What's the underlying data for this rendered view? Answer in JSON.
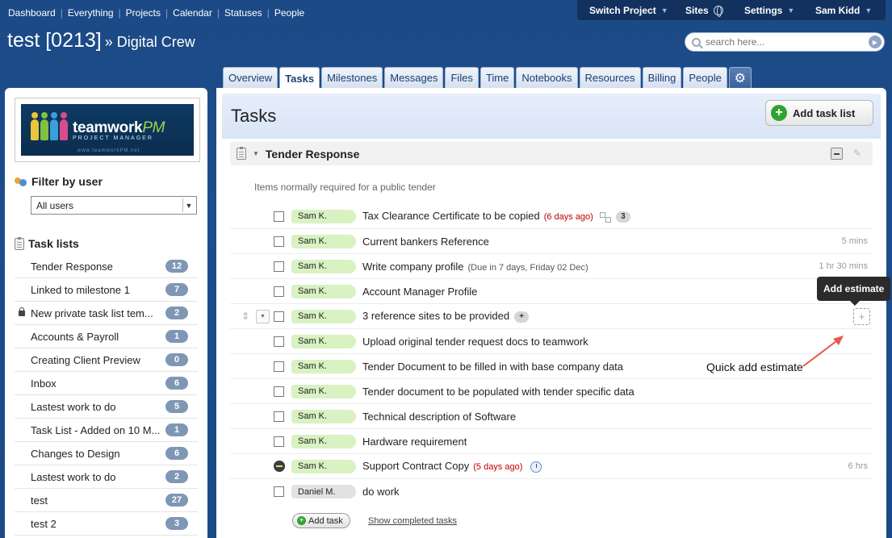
{
  "topnav": [
    "Dashboard",
    "Everything",
    "Projects",
    "Calendar",
    "Statuses",
    "People"
  ],
  "topright": {
    "switch_project": "Switch Project",
    "sites": "Sites",
    "settings": "Settings",
    "user": "Sam Kidd"
  },
  "project": {
    "title": "test [0213]",
    "company": "» Digital Crew"
  },
  "search": {
    "placeholder": "search here..."
  },
  "tabs": [
    "Overview",
    "Tasks",
    "Milestones",
    "Messages",
    "Files",
    "Time",
    "Notebooks",
    "Resources",
    "Billing",
    "People"
  ],
  "active_tab": "Tasks",
  "sidebar": {
    "logo": {
      "name_main": "teamwork",
      "name_pm": "PM",
      "sub": "PROJECT MANAGER",
      "url": "www.teamworkPM.net"
    },
    "filter_heading": "Filter by user",
    "filter_value": "All users",
    "tasklists_heading": "Task lists",
    "tasklists": [
      {
        "label": "Tender Response",
        "count": "12"
      },
      {
        "label": "Linked to milestone 1",
        "count": "7"
      },
      {
        "label": "New private task list tem...",
        "count": "2"
      },
      {
        "label": "Accounts & Payroll",
        "count": "1"
      },
      {
        "label": "Creating Client Preview",
        "count": "0"
      },
      {
        "label": "Inbox",
        "count": "6"
      },
      {
        "label": "Lastest work to do",
        "count": "5"
      },
      {
        "label": "Task List - Added on 10 M...",
        "count": "1"
      },
      {
        "label": "Changes to Design",
        "count": "6"
      },
      {
        "label": "Lastest work to do",
        "count": "2"
      },
      {
        "label": "test",
        "count": "27"
      },
      {
        "label": "test 2",
        "count": "3"
      }
    ]
  },
  "main": {
    "title": "Tasks",
    "add_task_list": "Add task list",
    "tasklist_title": "Tender Response",
    "tasklist_desc": "Items normally required for a public tender",
    "tasks": [
      {
        "assignee": "Sam K.",
        "name": "Tax Clearance Certificate to be copied",
        "late": "(6 days ago)",
        "comments": "3",
        "meta": ""
      },
      {
        "assignee": "Sam K.",
        "name": "Current bankers Reference",
        "meta": "5 mins"
      },
      {
        "assignee": "Sam K.",
        "name": "Write company profile",
        "due": "(Due in 7 days, Friday 02 Dec)",
        "meta": "1 hr 30 mins"
      },
      {
        "assignee": "Sam K.",
        "name": "Account Manager Profile",
        "meta": ""
      },
      {
        "assignee": "Sam K.",
        "name": "3 reference sites to be provided",
        "comments": "+",
        "meta": ""
      },
      {
        "assignee": "Sam K.",
        "name": "Upload original tender request docs to teamwork",
        "meta": ""
      },
      {
        "assignee": "Sam K.",
        "name": "Tender Document to be filled in with base company data",
        "meta": ""
      },
      {
        "assignee": "Sam K.",
        "name": "Tender document to be populated with tender specific data",
        "meta": ""
      },
      {
        "assignee": "Sam K.",
        "name": "Technical description of Software",
        "meta": ""
      },
      {
        "assignee": "Sam K.",
        "name": "Hardware requirement",
        "meta": ""
      },
      {
        "assignee": "Sam K.",
        "name": "Support Contract Copy",
        "late": "(5 days ago)",
        "meta": "6 hrs"
      },
      {
        "assignee": "Daniel M.",
        "name": "do work",
        "meta": ""
      }
    ],
    "add_task": "Add task",
    "show_completed": "Show completed tasks"
  },
  "tooltip": "Add estimate",
  "annotation": "Quick add estimate"
}
